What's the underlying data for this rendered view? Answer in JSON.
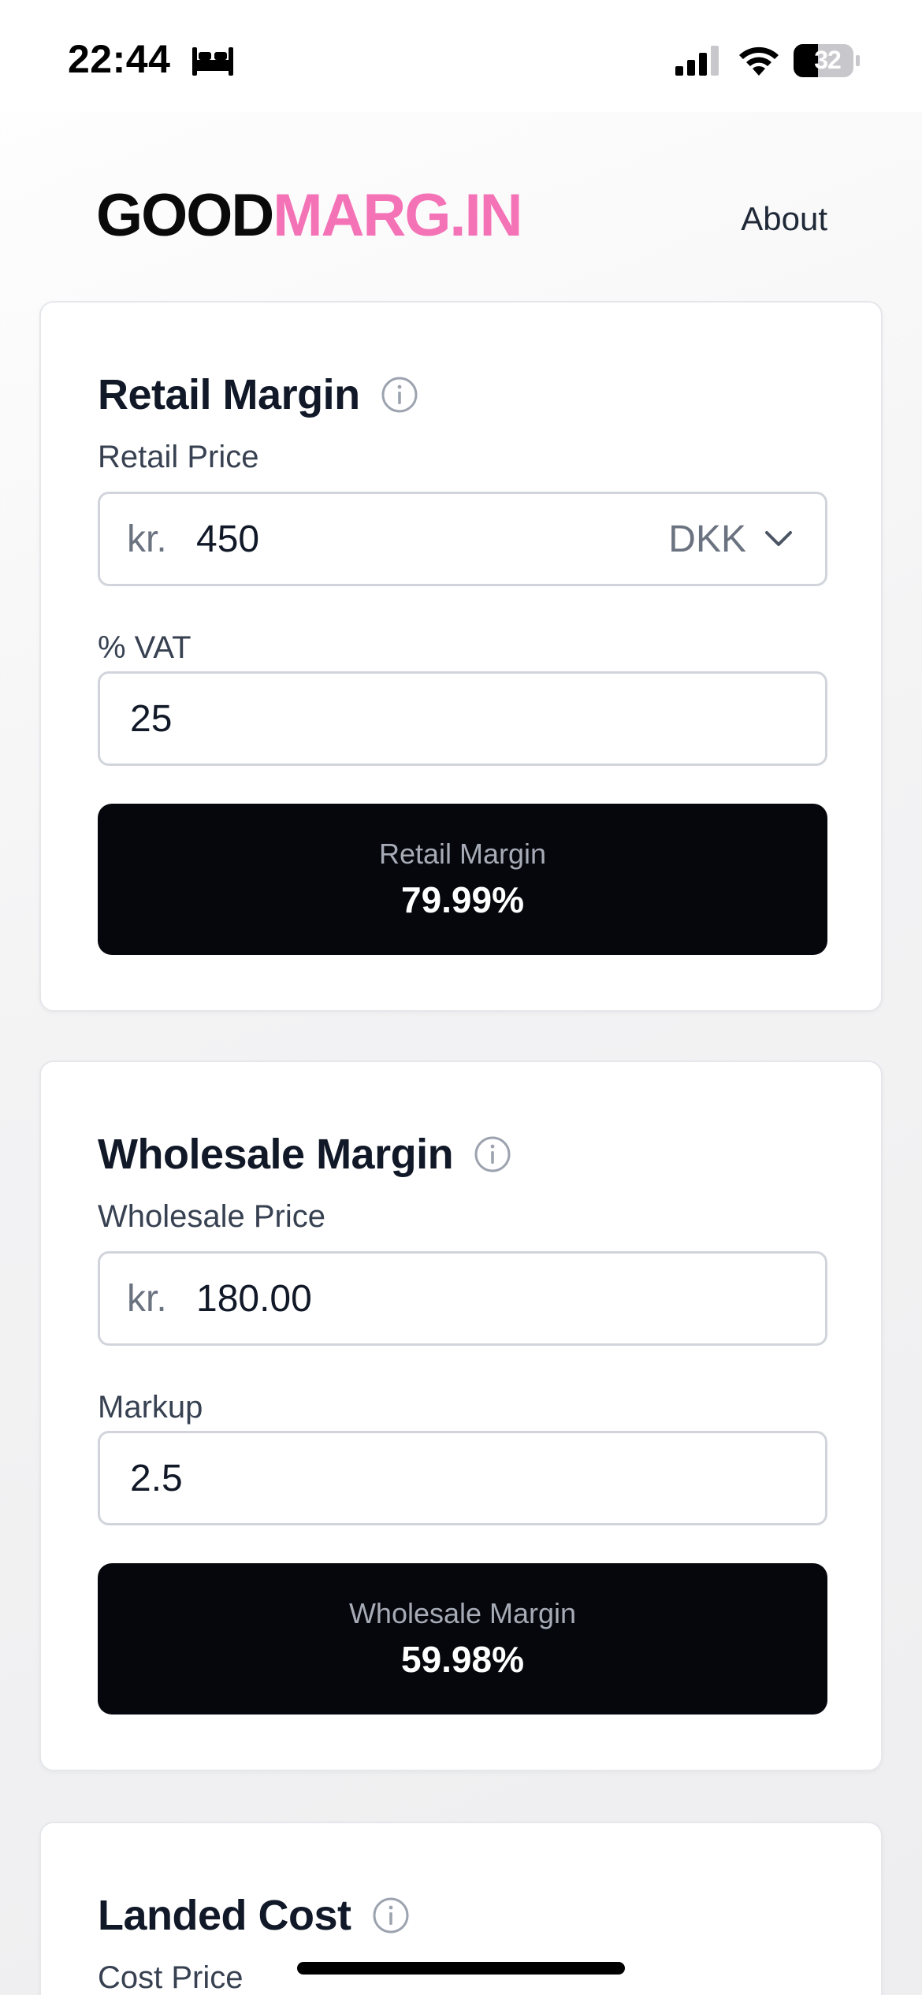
{
  "status_bar": {
    "time": "22:44",
    "battery": "32",
    "icons": [
      "bed-icon",
      "cellular-signal-icon",
      "wifi-icon",
      "battery-icon"
    ]
  },
  "header": {
    "logo_part1": "GOOD",
    "logo_part2": "MARG.IN",
    "about_label": "About"
  },
  "colors": {
    "brand_pink": "#f472b6",
    "result_bg": "#05070d"
  },
  "retail": {
    "title": "Retail Margin",
    "price_label": "Retail Price",
    "price_prefix": "kr.",
    "price_value": "450",
    "currency": "DKK",
    "vat_label": "% VAT",
    "vat_value": "25",
    "result_label": "Retail Margin",
    "result_value": "79.99%"
  },
  "wholesale": {
    "title": "Wholesale Margin",
    "price_label": "Wholesale Price",
    "price_prefix": "kr.",
    "price_value": "180.00",
    "markup_label": "Markup",
    "markup_value": "2.5",
    "result_label": "Wholesale Margin",
    "result_value": "59.98%"
  },
  "landed": {
    "title": "Landed Cost",
    "cost_label": "Cost Price"
  }
}
